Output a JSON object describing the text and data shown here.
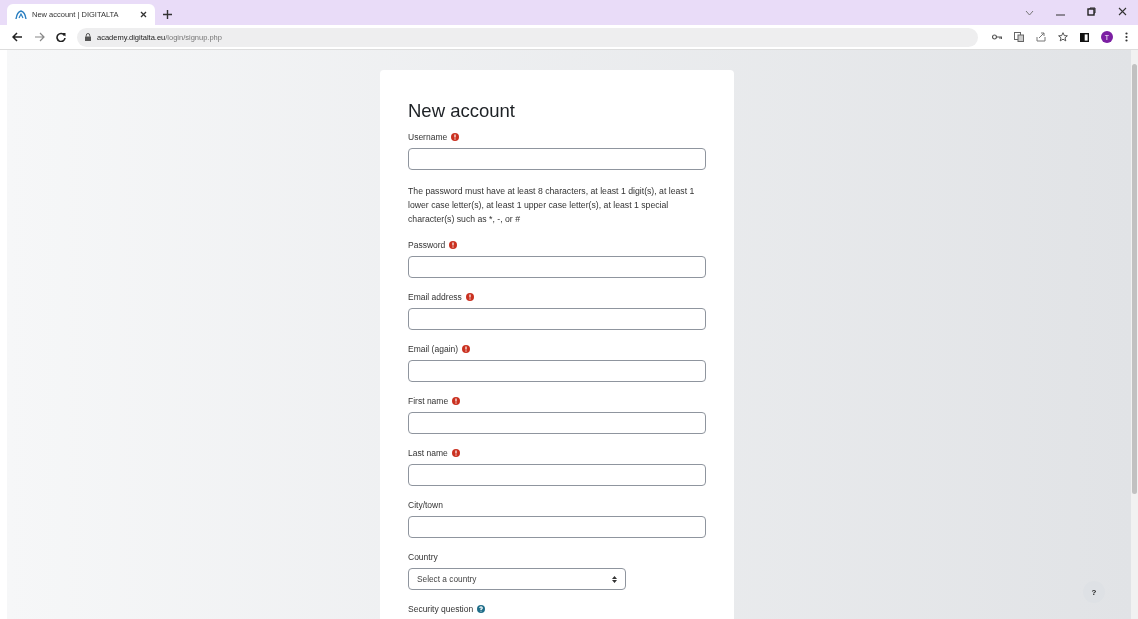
{
  "browser": {
    "tab": {
      "title": "New account | DIGITALTA",
      "selected": true
    },
    "url_host": "academy.digitalta.eu",
    "url_path": "/login/signup.php",
    "profile_initial": "T"
  },
  "form": {
    "title": "New account",
    "fields": [
      {
        "kind": "text",
        "label": "Username",
        "required": true
      },
      {
        "kind": "note",
        "text": "The password must have at least 8 characters, at least 1 digit(s), at least 1 lower case letter(s), at least 1 upper case letter(s), at least 1 special character(s) such as *, -, or #"
      },
      {
        "kind": "text",
        "label": "Password",
        "required": true
      },
      {
        "kind": "text",
        "label": "Email address",
        "required": true
      },
      {
        "kind": "text",
        "label": "Email (again)",
        "required": true
      },
      {
        "kind": "text",
        "label": "First name",
        "required": true
      },
      {
        "kind": "text",
        "label": "Last name",
        "required": true
      },
      {
        "kind": "text",
        "label": "City/town"
      },
      {
        "kind": "select",
        "label": "Country",
        "value": "Select a country"
      },
      {
        "kind": "label",
        "label": "Security question",
        "help": true
      }
    ]
  },
  "help_button": {
    "label": "?"
  }
}
